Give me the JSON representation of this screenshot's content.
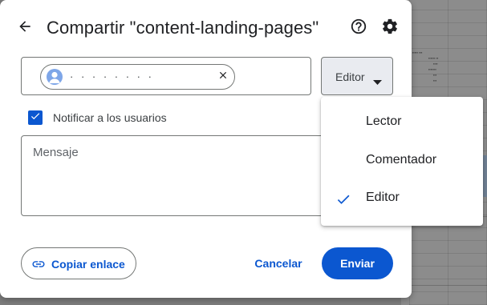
{
  "dialog": {
    "title": "Compartir \"content-landing-pages\"",
    "recipient_chip": {
      "label": "· · · · · · · ·"
    },
    "role_dropdown": {
      "selected": "Editor"
    },
    "notify": {
      "label": "Notificar a los usuarios",
      "checked": true
    },
    "message": {
      "placeholder": "Mensaje"
    },
    "footer": {
      "copy_link_label": "Copiar enlace",
      "cancel_label": "Cancelar",
      "send_label": "Enviar"
    }
  },
  "role_menu": {
    "items": [
      {
        "label": "Lector",
        "selected": false
      },
      {
        "label": "Comentador",
        "selected": false
      },
      {
        "label": "Editor",
        "selected": true
      }
    ]
  },
  "colors": {
    "accent": "#0b57d0",
    "dropdown_bg": "#e9ebf0",
    "text": "#202124"
  },
  "icons": {
    "back": "arrow-back-icon",
    "help": "help-circle-icon",
    "settings": "gear-icon",
    "chip_avatar": "person-avatar-icon",
    "chip_remove": "close-icon",
    "dropdown": "caret-down-icon",
    "checkbox": "check-icon",
    "copy_link": "link-icon",
    "menu_selected": "check-icon"
  }
}
